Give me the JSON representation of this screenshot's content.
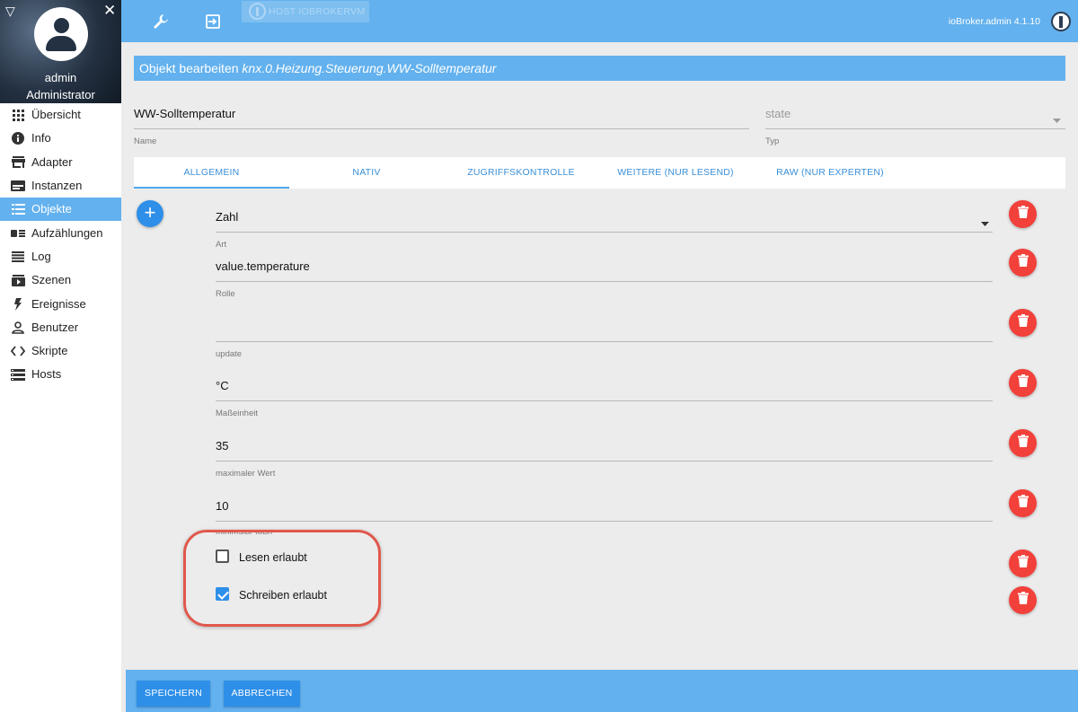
{
  "sidebar": {
    "user": "admin",
    "role": "Administrator",
    "items": [
      {
        "label": "Übersicht",
        "icon": "apps-grid-icon"
      },
      {
        "label": "Info",
        "icon": "info-icon"
      },
      {
        "label": "Adapter",
        "icon": "store-icon"
      },
      {
        "label": "Instanzen",
        "icon": "instances-icon"
      },
      {
        "label": "Objekte",
        "icon": "list-icon",
        "active": true
      },
      {
        "label": "Aufzählungen",
        "icon": "enums-icon"
      },
      {
        "label": "Log",
        "icon": "log-icon"
      },
      {
        "label": "Szenen",
        "icon": "scenes-icon"
      },
      {
        "label": "Ereignisse",
        "icon": "flash-icon"
      },
      {
        "label": "Benutzer",
        "icon": "user-icon"
      },
      {
        "label": "Skripte",
        "icon": "code-icon"
      },
      {
        "label": "Hosts",
        "icon": "hosts-icon"
      }
    ]
  },
  "topbar": {
    "host": "HOST IOBROKERVM",
    "version": "ioBroker.admin 4.1.10"
  },
  "panel": {
    "title_prefix": "Objekt bearbeiten",
    "object_id": "knx.0.Heizung.Steuerung.WW-Solltemperatur"
  },
  "header_fields": {
    "name_value": "WW-Solltemperatur",
    "name_label": "Name",
    "type_value": "state",
    "type_label": "Typ"
  },
  "tabs": [
    "ALLGEMEIN",
    "NATIV",
    "ZUGRIFFSKONTROLLE",
    "WEITERE (NUR LESEND)",
    "RAW (NUR EXPERTEN)"
  ],
  "fields": [
    {
      "value": "Zahl",
      "label": "Art",
      "select": true
    },
    {
      "value": "value.temperature",
      "label": "Rolle"
    },
    {
      "value": "",
      "label": "update"
    },
    {
      "value": "°C",
      "label": "Maßeinheit"
    },
    {
      "value": "35",
      "label": "maximaler Wert"
    },
    {
      "value": "10",
      "label": "minimaler Wert"
    }
  ],
  "checkboxes": [
    {
      "label": "Lesen erlaubt",
      "checked": false
    },
    {
      "label": "Schreiben erlaubt",
      "checked": true
    }
  ],
  "footer": {
    "save": "SPEICHERN",
    "cancel": "ABBRECHEN"
  },
  "colors": {
    "primary": "#63b1ee",
    "button": "#2e8fe8",
    "delete": "#f2403a",
    "highlight": "#e0584c"
  }
}
